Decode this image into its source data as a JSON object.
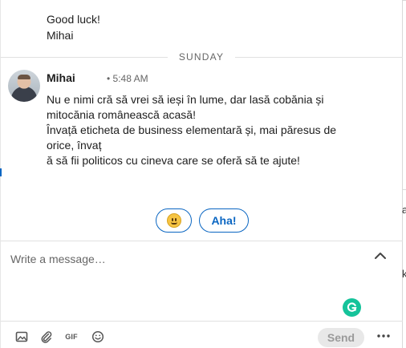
{
  "previous_message": {
    "lines": [
      "Good luck!",
      "Mihai"
    ]
  },
  "day_divider": {
    "label": "SUNDAY"
  },
  "message": {
    "sender": "Mihai",
    "time": "• 5:48 AM",
    "lines": [
      "Nu e nimi cră să vrei să ieși în lume, dar lasă cobănia și",
      "mitocănia românească acasă!",
      "Învață eticheta de business elementară și, mai păresus de",
      "orice, învaț",
      "ă să fii politicos cu cineva care se oferă să te ajute!"
    ]
  },
  "quick_replies": {
    "emoji_icon": "slightly-smiling-face-icon",
    "aha_label": "Aha!"
  },
  "compose": {
    "placeholder": "Write a message…",
    "value": ""
  },
  "toolbar": {
    "icons": [
      "image-icon",
      "paperclip-icon",
      "gif-icon",
      "emoji-icon"
    ],
    "gif_label": "GIF",
    "send_label": "Send",
    "more_icon": "more-horizontal-icon"
  },
  "colors": {
    "accent": "#0a66c2",
    "grammarly": "#15c39a",
    "send_disabled_bg": "#e8e8e8",
    "send_disabled_text": "#9a9a9a"
  },
  "gutter_glyphs": {
    "first": "al",
    "second": "k"
  }
}
